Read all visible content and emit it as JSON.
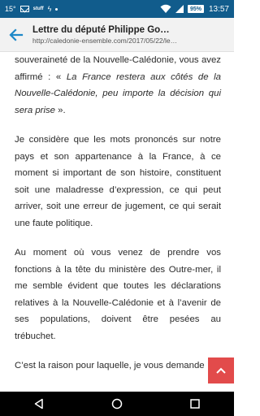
{
  "status_bar": {
    "temperature": "15°",
    "notification_text": "stuff",
    "battery": "95%",
    "time": "13:57"
  },
  "header": {
    "title": "Lettre du député Philippe Go…",
    "url": "http://caledonie-ensemble.com/2017/05/22/le…"
  },
  "article": {
    "p1_before": "souveraineté de la Nouvelle-Calédonie, vous avez affirmé : « ",
    "p1_quote": "La France restera aux côtés de la Nouvelle-Calédonie, peu importe la décision qui sera prise",
    "p1_after": " ».",
    "p2": "Je considère que les mots prononcés sur notre pays et son appartenance à la France, à ce moment si important de son histoire, constituent soit une maladresse d’expression, ce qui peut arriver, soit une erreur de jugement, ce qui serait une faute politique.",
    "p3": "Au moment où vous venez de prendre vos fonctions à la tête du ministère des Outre-mer, il me semble évident que toutes les déclarations relatives à la Nouvelle-Calédonie et à l’avenir de ses populations, doivent être pesées au trébuchet.",
    "p4": "C’est la raison pour laquelle, je vous demande"
  },
  "icons": {
    "back": "arrow-left-icon",
    "scroll_top": "chevron-up-icon",
    "nav_back": "triangle-back-icon",
    "nav_home": "circle-home-icon",
    "nav_recent": "square-recent-icon"
  },
  "colors": {
    "status_bar": "#115c8c",
    "accent": "#1e88c8",
    "scroll_top": "#e24b4b"
  }
}
